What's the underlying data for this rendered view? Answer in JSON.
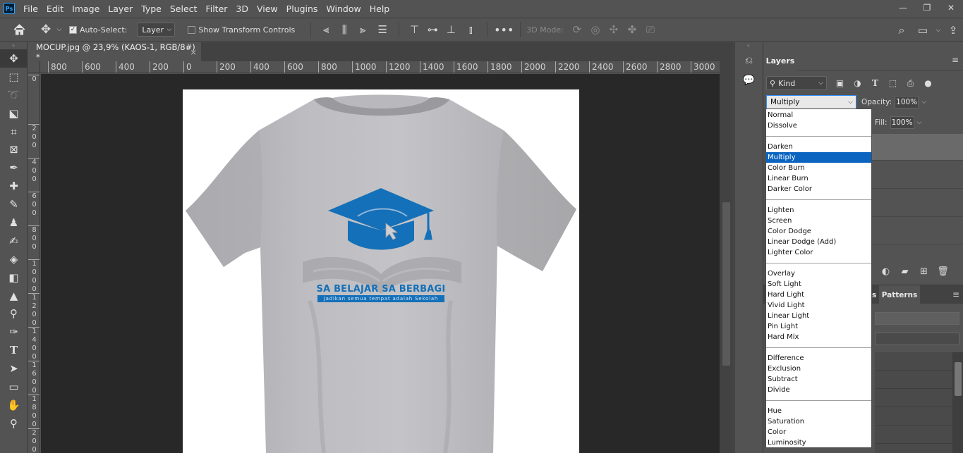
{
  "menubar": {
    "logo": "Ps",
    "items": [
      "File",
      "Edit",
      "Image",
      "Layer",
      "Type",
      "Select",
      "Filter",
      "3D",
      "View",
      "Plugins",
      "Window",
      "Help"
    ]
  },
  "options": {
    "auto_select_label": "Auto-Select:",
    "auto_select_target": "Layer",
    "transform_label": "Show Transform Controls",
    "mode_3d": "3D Mode:"
  },
  "document": {
    "tab_title": "MOCUP.jpg @ 23,9% (KAOS-1, RGB/8#) *",
    "close": "×"
  },
  "rulers": {
    "horizontal": [
      "800",
      "600",
      "400",
      "200",
      "0",
      "200",
      "400",
      "600",
      "800",
      "1000",
      "1200",
      "1400",
      "1600",
      "1800",
      "2000",
      "2200",
      "2400",
      "2600",
      "2800",
      "3000"
    ],
    "vertical": [
      "0",
      "2\n0\n0",
      "4\n0\n0",
      "6\n0\n0",
      "8\n0\n0",
      "1\n0\n0\n0",
      "1\n2\n0\n0",
      "1\n4\n0\n0",
      "1\n6\n0\n0",
      "1\n8\n0\n0",
      "2\n0\n0\n0"
    ]
  },
  "artwork": {
    "headline": "SA BELAJAR SA BERBAGI",
    "tagline": "Jadikan semua tempat adalah Sekolah",
    "accent": "#1470b8",
    "shirt": "#b6b6ba"
  },
  "layers_panel": {
    "tab": "Layers",
    "kind_label": "Kind",
    "blend_mode": "Multiply",
    "opacity_label": "Opacity:",
    "opacity_value": "100%",
    "fill_label": "Fill:",
    "fill_value": "100%",
    "bottom_tab_partial": "s",
    "patterns_tab": "Patterns"
  },
  "blend_modes": {
    "selected": "Multiply",
    "groups": [
      [
        "Normal",
        "Dissolve"
      ],
      [
        "Darken",
        "Multiply",
        "Color Burn",
        "Linear Burn",
        "Darker Color"
      ],
      [
        "Lighten",
        "Screen",
        "Color Dodge",
        "Linear Dodge (Add)",
        "Lighter Color"
      ],
      [
        "Overlay",
        "Soft Light",
        "Hard Light",
        "Vivid Light",
        "Linear Light",
        "Pin Light",
        "Hard Mix"
      ],
      [
        "Difference",
        "Exclusion",
        "Subtract",
        "Divide"
      ],
      [
        "Hue",
        "Saturation",
        "Color",
        "Luminosity"
      ]
    ]
  },
  "colors": {
    "selection": "#0a64c0",
    "ui_bg": "#535353",
    "pasteboard": "#282828"
  }
}
